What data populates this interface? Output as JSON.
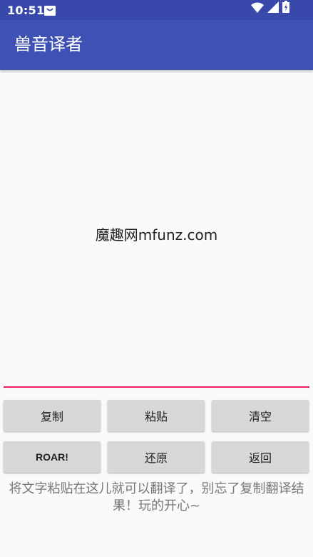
{
  "status_bar": {
    "time": "10:51",
    "icons": [
      "notification-bag-icon",
      "wifi-icon",
      "signal-icon",
      "battery-icon"
    ]
  },
  "app_bar": {
    "title": "兽音译者"
  },
  "main": {
    "text": "魔趣网mfunz.com"
  },
  "buttons": {
    "copy": "复制",
    "paste": "粘贴",
    "clear": "清空",
    "roar": "ROAR!",
    "restore": "还原",
    "back": "返回"
  },
  "hint": "将文字粘贴在这儿就可以翻译了，别忘了复制翻译结果！玩的开心~",
  "colors": {
    "status_bar": "#3949ab",
    "app_bar": "#3f51b5",
    "accent_line": "#e91e63",
    "button": "#d6d7d7",
    "background": "#fafafa"
  }
}
